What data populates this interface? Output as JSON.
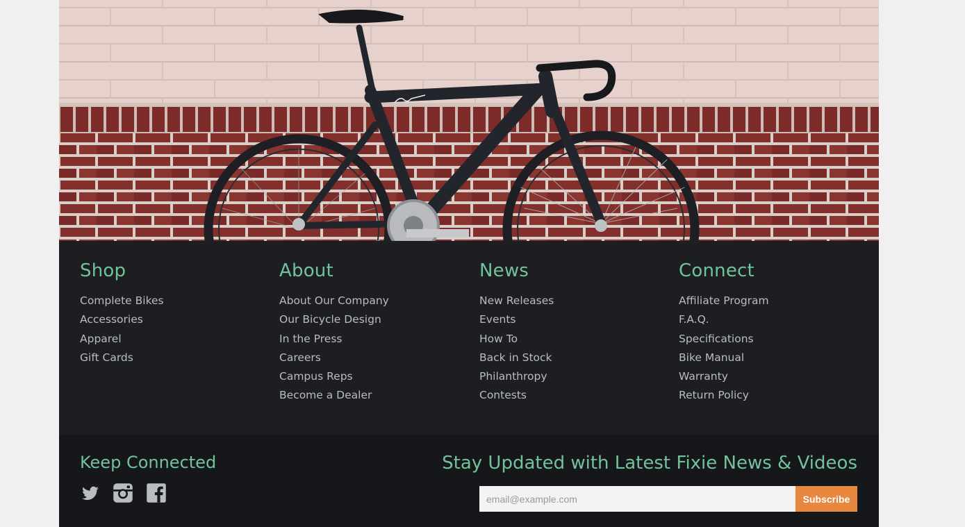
{
  "hero": {
    "image": "black-fixie-bicycle-against-brick-wall-photo"
  },
  "footer": {
    "columns": [
      {
        "title": "Shop",
        "links": [
          "Complete Bikes",
          "Accessories",
          "Apparel",
          "Gift Cards"
        ]
      },
      {
        "title": "About",
        "links": [
          "About Our Company",
          "Our Bicycle Design",
          "In the Press",
          "Careers",
          "Campus Reps",
          "Become a Dealer"
        ]
      },
      {
        "title": "News",
        "links": [
          "New Releases",
          "Events",
          "How To",
          "Back in Stock",
          "Philanthropy",
          "Contests"
        ]
      },
      {
        "title": "Connect",
        "links": [
          "Affiliate Program",
          "F.A.Q.",
          "Specifications",
          "Bike Manual",
          "Warranty",
          "Return Policy"
        ]
      }
    ],
    "keep_connected": {
      "title": "Keep Connected",
      "icons": [
        "twitter-icon",
        "instagram-icon",
        "facebook-icon"
      ]
    },
    "newsletter": {
      "title": "Stay Updated with Latest Fixie News & Videos",
      "placeholder": "email@example.com",
      "button_label": "Subscribe"
    }
  },
  "colors": {
    "accent_green": "#72c39a",
    "footer_bg": "#1c1e22",
    "footer_bottom_bg": "#16171a",
    "subscribe_orange": "#e8873f",
    "link_text": "#b9bcc1"
  }
}
